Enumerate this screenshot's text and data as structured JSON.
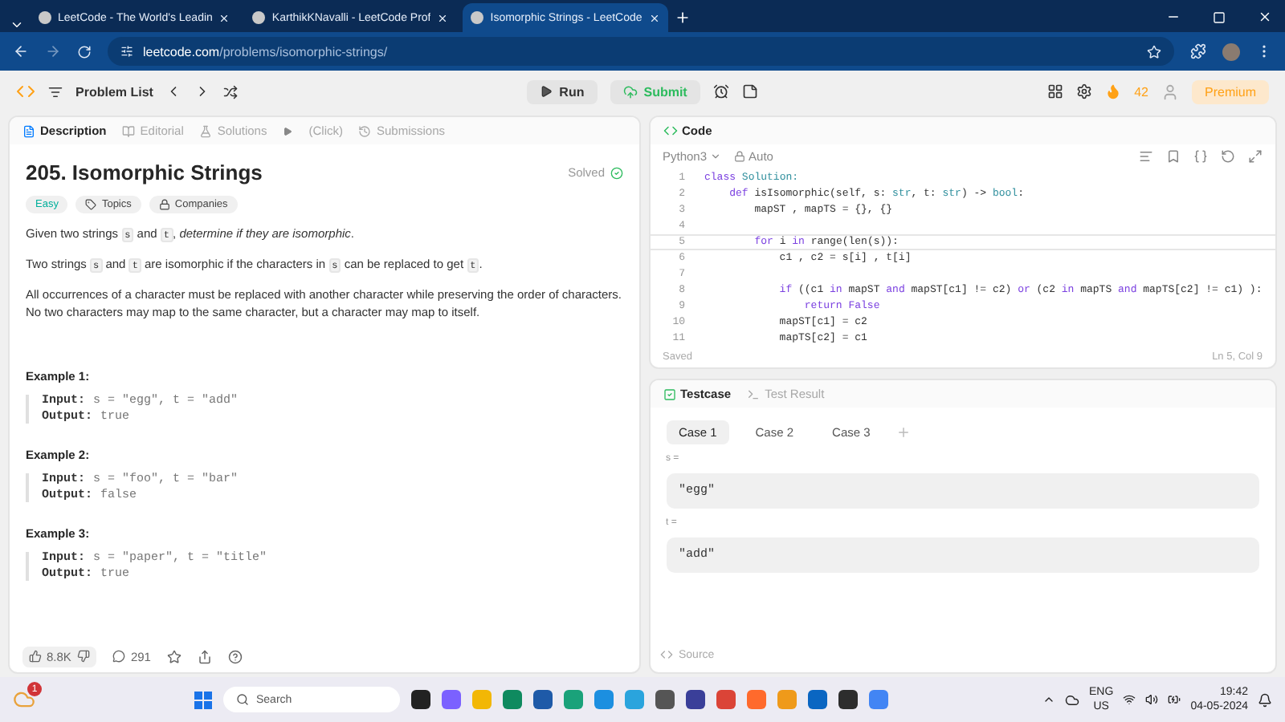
{
  "browser": {
    "tabs": [
      {
        "title": "LeetCode - The World's Leadin",
        "selected": false
      },
      {
        "title": "KarthikKNavalli - LeetCode Prof",
        "selected": false
      },
      {
        "title": "Isomorphic Strings - LeetCode",
        "selected": true
      }
    ],
    "url": {
      "host": "leetcode.com",
      "path": "/problems/isomorphic-strings/"
    }
  },
  "nav": {
    "problem_list": "Problem List",
    "run": "Run",
    "submit": "Submit",
    "streak": "42",
    "premium": "Premium"
  },
  "description": {
    "tabs": [
      {
        "label": "Description",
        "selected": true
      },
      {
        "label": "Editorial",
        "selected": false
      },
      {
        "label": "Solutions",
        "selected": false,
        "extra": "(Click)"
      },
      {
        "label": "Submissions",
        "selected": false
      }
    ],
    "title": "205. Isomorphic Strings",
    "status": "Solved",
    "tags": [
      {
        "label": "Easy",
        "kind": "difficulty"
      },
      {
        "label": "Topics",
        "kind": "topics"
      },
      {
        "label": "Companies",
        "kind": "companies"
      }
    ],
    "paragraphs": [
      [
        {
          "text": "Given two strings ",
          "kind": "text"
        },
        {
          "text": "s",
          "kind": "code"
        },
        {
          "text": " and ",
          "kind": "text"
        },
        {
          "text": "t",
          "kind": "code"
        },
        {
          "text": ", ",
          "kind": "text"
        },
        {
          "text": "determine if they are isomorphic",
          "kind": "italic"
        },
        {
          "text": ".",
          "kind": "text"
        }
      ],
      [
        {
          "text": "Two strings ",
          "kind": "text"
        },
        {
          "text": "s",
          "kind": "code"
        },
        {
          "text": " and ",
          "kind": "text"
        },
        {
          "text": "t",
          "kind": "code"
        },
        {
          "text": " are isomorphic if the characters in ",
          "kind": "text"
        },
        {
          "text": "s",
          "kind": "code"
        },
        {
          "text": " can be replaced to get ",
          "kind": "text"
        },
        {
          "text": "t",
          "kind": "code"
        },
        {
          "text": ".",
          "kind": "text"
        }
      ],
      [
        {
          "text": "All occurrences of a character must be replaced with another character while preserving the order of characters. No two characters may map to the same character, but a character may map to itself.",
          "kind": "text"
        }
      ]
    ],
    "examples": [
      {
        "title": "Example 1:",
        "input_label": "Input:",
        "input": "s = \"egg\", t = \"add\"",
        "output_label": "Output:",
        "output": "true"
      },
      {
        "title": "Example 2:",
        "input_label": "Input:",
        "input": "s = \"foo\", t = \"bar\"",
        "output_label": "Output:",
        "output": "false"
      },
      {
        "title": "Example 3:",
        "input_label": "Input:",
        "input": "s = \"paper\", t = \"title\"",
        "output_label": "Output:",
        "output": "true"
      }
    ],
    "likes": "8.8K",
    "comments": "291"
  },
  "code": {
    "title": "Code",
    "language": "Python3",
    "mode": "Auto",
    "lines": [
      {
        "number": "1",
        "current": false,
        "tokens": [
          {
            "text": "class",
            "kind": "kw"
          },
          {
            "text": " Solution:",
            "kind": "type"
          }
        ]
      },
      {
        "number": "2",
        "current": false,
        "tokens": [
          {
            "text": "    def",
            "kind": "kw"
          },
          {
            "text": " isIsomorphic(self, s: ",
            "kind": "plain"
          },
          {
            "text": "str",
            "kind": "type"
          },
          {
            "text": ", t: ",
            "kind": "plain"
          },
          {
            "text": "str",
            "kind": "type"
          },
          {
            "text": ") -> ",
            "kind": "plain"
          },
          {
            "text": "bool",
            "kind": "type"
          },
          {
            "text": ":",
            "kind": "plain"
          }
        ]
      },
      {
        "number": "3",
        "current": false,
        "tokens": [
          {
            "text": "        mapST , mapTS = {}, {}",
            "kind": "plain"
          }
        ]
      },
      {
        "number": "4",
        "current": false
      },
      {
        "number": "5",
        "current": true,
        "tokens": [
          {
            "text": "        for",
            "kind": "kw"
          },
          {
            "text": " i ",
            "kind": "plain"
          },
          {
            "text": "in",
            "kind": "kw"
          },
          {
            "text": " range(len(s)):",
            "kind": "plain"
          }
        ]
      },
      {
        "number": "6",
        "current": false,
        "tokens": [
          {
            "text": "            c1 , c2 = s[i] , t[i]",
            "kind": "plain"
          }
        ]
      },
      {
        "number": "7",
        "current": false
      },
      {
        "number": "8",
        "current": false,
        "tokens": [
          {
            "text": "            if",
            "kind": "kw"
          },
          {
            "text": " ((c1 ",
            "kind": "plain"
          },
          {
            "text": "in",
            "kind": "kw"
          },
          {
            "text": " mapST ",
            "kind": "plain"
          },
          {
            "text": "and",
            "kind": "kw"
          },
          {
            "text": " mapST[c1] != c2) ",
            "kind": "plain"
          },
          {
            "text": "or",
            "kind": "kw"
          },
          {
            "text": " (c2 ",
            "kind": "plain"
          },
          {
            "text": "in",
            "kind": "kw"
          },
          {
            "text": " mapTS ",
            "kind": "plain"
          },
          {
            "text": "and",
            "kind": "kw"
          },
          {
            "text": " mapTS[c2] != c1) ):",
            "kind": "plain"
          }
        ]
      },
      {
        "number": "9",
        "current": false,
        "tokens": [
          {
            "text": "                return False",
            "kind": "kw"
          }
        ]
      },
      {
        "number": "10",
        "current": false,
        "tokens": [
          {
            "text": "            mapST[c1] = c2",
            "kind": "plain"
          }
        ]
      },
      {
        "number": "11",
        "current": false,
        "tokens": [
          {
            "text": "            mapTS[c2] = c1",
            "kind": "plain"
          }
        ]
      }
    ],
    "saved": "Saved",
    "cursor": "Ln 5, Col 9"
  },
  "testcase": {
    "tabs": [
      {
        "label": "Testcase",
        "selected": true
      },
      {
        "label": "Test Result",
        "selected": false
      }
    ],
    "cases": [
      {
        "label": "Case 1",
        "selected": true
      },
      {
        "label": "Case 2",
        "selected": false
      },
      {
        "label": "Case 3",
        "selected": false
      }
    ],
    "params": [
      {
        "name": "s =",
        "value": "\"egg\""
      },
      {
        "name": "t =",
        "value": "\"add\""
      }
    ],
    "source": "Source"
  },
  "taskbar": {
    "notifications": "1",
    "search": "Search",
    "lang": "ENG",
    "region": "US",
    "time": "19:42",
    "date": "04-05-2024"
  }
}
